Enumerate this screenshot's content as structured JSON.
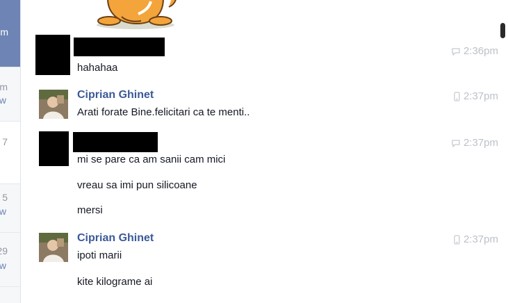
{
  "sidebar": {
    "items": [
      {
        "line1": "m",
        "line2": ""
      },
      {
        "line1": "m",
        "line2": "w"
      },
      {
        "line1": "7",
        "line2": ""
      },
      {
        "line1": "5",
        "line2": "w"
      },
      {
        "line1": "29",
        "line2": "w"
      }
    ]
  },
  "messages": [
    {
      "sender": "",
      "lines": [
        "hahahaa"
      ],
      "time": "2:36pm",
      "time_icon": "chat-bubble-icon",
      "avatar": "redacted"
    },
    {
      "sender": "Ciprian Ghinet",
      "lines": [
        "Arati forate Bine.felicitari ca te menti.."
      ],
      "time": "2:37pm",
      "time_icon": "mobile-phone-icon",
      "avatar": "photo"
    },
    {
      "sender": "",
      "lines": [
        "mi se pare ca am sanii cam mici",
        "vreau sa imi pun silicoane",
        "mersi"
      ],
      "time": "2:37pm",
      "time_icon": "chat-bubble-icon",
      "avatar": "redacted"
    },
    {
      "sender": "Ciprian Ghinet",
      "lines": [
        "ipoti marii",
        "kite kilograme ai"
      ],
      "time": "2:37pm",
      "time_icon": "mobile-phone-icon",
      "avatar": "photo"
    }
  ],
  "colors": {
    "sender_link": "#3b5998",
    "timestamp": "#bdc1c9",
    "sidebar_active": "#6d84b4"
  }
}
